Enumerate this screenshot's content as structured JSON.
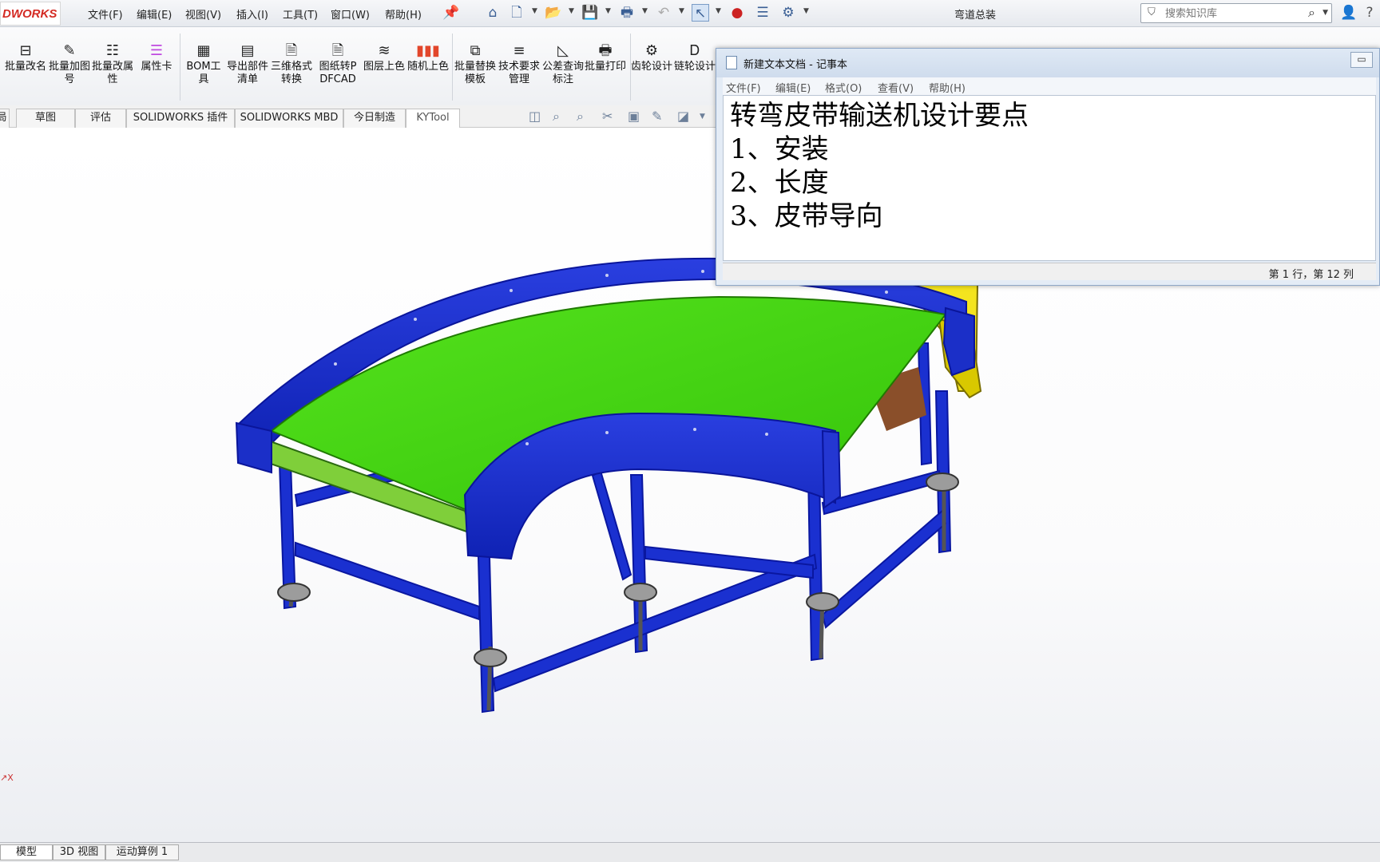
{
  "app": {
    "logo_text": "DWORKS",
    "document_title": "弯道总装",
    "menu": [
      "文件(F)",
      "编辑(E)",
      "视图(V)",
      "插入(I)",
      "工具(T)",
      "窗口(W)",
      "帮助(H)"
    ]
  },
  "search": {
    "placeholder": "搜索知识库"
  },
  "ribbon": {
    "buttons": [
      {
        "label": "批量改名",
        "icon": "rename-icon"
      },
      {
        "label": "批量加图号",
        "icon": "edit-pencil-icon"
      },
      {
        "label": "批量改属性",
        "icon": "list-icon"
      },
      {
        "label": "属性卡",
        "icon": "property-card-icon"
      },
      {
        "label": "BOM工具",
        "icon": "table-icon"
      },
      {
        "label": "导出部件清单",
        "icon": "export-list-icon"
      },
      {
        "label": "三维格式转换",
        "icon": "pdf-icon"
      },
      {
        "label": "图纸转PDFCAD",
        "icon": "pdf-icon"
      },
      {
        "label": "图层上色",
        "icon": "layers-icon"
      },
      {
        "label": "随机上色",
        "icon": "color-bars-icon"
      },
      {
        "label": "批量替换模板",
        "icon": "template-icon"
      },
      {
        "label": "技术要求管理",
        "icon": "text-lines-icon"
      },
      {
        "label": "公差查询标注",
        "icon": "tolerance-icon"
      },
      {
        "label": "批量打印",
        "icon": "printer-icon"
      },
      {
        "label": "齿轮设计",
        "icon": "gear-icon"
      },
      {
        "label": "链轮设计",
        "icon": "sprocket-icon"
      }
    ]
  },
  "tabs": {
    "items": [
      "局",
      "草图",
      "评估",
      "SOLIDWORKS 插件",
      "SOLIDWORKS MBD",
      "今日制造",
      "KYTool"
    ],
    "active": "KYTool"
  },
  "notepad": {
    "title": "新建文本文档 - 记事本",
    "menu": [
      "文件(F)",
      "编辑(E)",
      "格式(O)",
      "查看(V)",
      "帮助(H)"
    ],
    "lines": [
      "转弯皮带输送机设计要点",
      "1、安装",
      "2、长度",
      "3、皮带导向"
    ],
    "status": "第 1 行，第 12 列"
  },
  "viewport": {
    "triad_label": "X",
    "colors": {
      "frame": "#1428c8",
      "belt": "#3ed60a",
      "motor": "#f0e21e",
      "feet": "#8a8a8a"
    }
  },
  "bottom_tabs": [
    "模型",
    "3D 视图",
    "运动算例 1"
  ]
}
